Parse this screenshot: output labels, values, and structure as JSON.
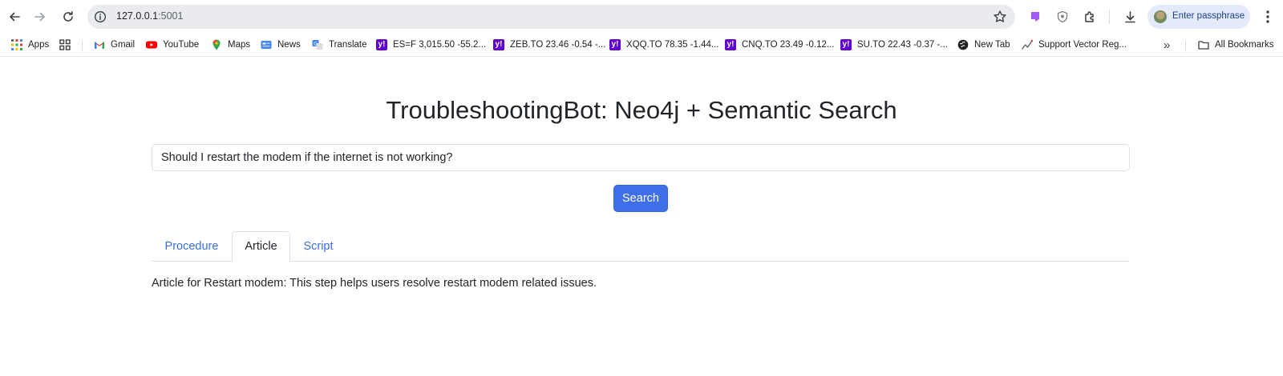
{
  "browser": {
    "url_host": "127.0.0.1",
    "url_port": ":5001",
    "profile_label": "Enter passphrase",
    "icons": {
      "back": "arrow-left-icon",
      "forward": "arrow-right-icon",
      "reload": "reload-icon",
      "info": "info-icon",
      "star": "star-icon",
      "extension_purple": "purple-extension-icon",
      "shield": "shield-icon",
      "extensions": "puzzle-icon",
      "download": "download-icon",
      "menu": "kebab-menu-icon"
    }
  },
  "bookmarks": {
    "items": [
      {
        "label": "Apps"
      },
      {
        "label": "Gmail"
      },
      {
        "label": "YouTube"
      },
      {
        "label": "Maps"
      },
      {
        "label": "News"
      },
      {
        "label": "Translate"
      },
      {
        "label": "ES=F 3,015.50 -55.2..."
      },
      {
        "label": "ZEB.TO 23.46 -0.54 -..."
      },
      {
        "label": "XQQ.TO 78.35 -1.44..."
      },
      {
        "label": "CNQ.TO 23.49 -0.12..."
      },
      {
        "label": "SU.TO 22.43 -0.37 -..."
      },
      {
        "label": "New Tab"
      },
      {
        "label": "Support Vector Reg..."
      }
    ],
    "overflow": "»",
    "all_bookmarks": "All Bookmarks"
  },
  "main": {
    "title": "TroubleshootingBot: Neo4j + Semantic Search",
    "search_value": "Should I restart the modem if the internet is not working?",
    "search_button": "Search",
    "tabs": [
      {
        "label": "Procedure",
        "active": false
      },
      {
        "label": "Article",
        "active": true
      },
      {
        "label": "Script",
        "active": false
      }
    ],
    "result": "Article for Restart modem: This step helps users resolve restart modem related issues."
  },
  "colors": {
    "accent": "#3f6fe8",
    "tab_link": "#3b6fd8",
    "yahoo_purple": "#6001d2"
  }
}
